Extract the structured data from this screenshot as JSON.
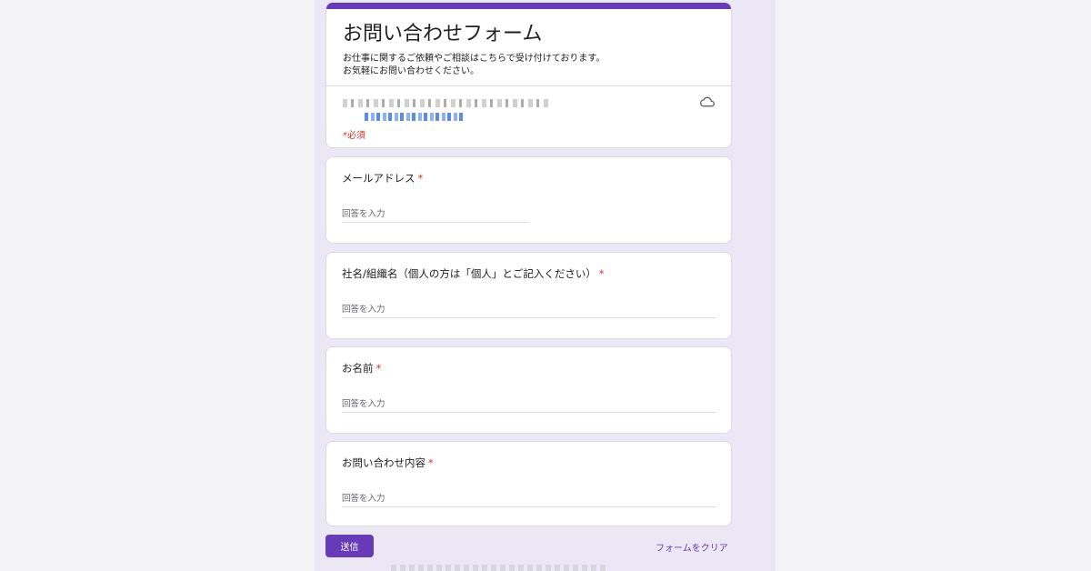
{
  "form": {
    "title": "お問い合わせフォーム",
    "description_lines": [
      "お仕事に関するご依頼やご相談はこちらで受け付けております。",
      "お気軽にお問い合わせください。"
    ],
    "required_note": "*必須",
    "accent_color": "#673ab7",
    "required_color": "#d93025"
  },
  "questions": [
    {
      "label": "メールアドレス",
      "required_mark": "*",
      "placeholder": "回答を入力",
      "value": ""
    },
    {
      "label": "社名/組織名（個人の方は「個人」とご記入ください）",
      "required_mark": "*",
      "placeholder": "回答を入力",
      "value": ""
    },
    {
      "label": "お名前",
      "required_mark": "*",
      "placeholder": "回答を入力",
      "value": ""
    },
    {
      "label": "お問い合わせ内容",
      "required_mark": "*",
      "placeholder": "回答を入力",
      "value": ""
    }
  ],
  "actions": {
    "submit_label": "送信",
    "clear_label": "フォームをクリア"
  },
  "icons": {
    "save_status": "cloud-icon"
  }
}
